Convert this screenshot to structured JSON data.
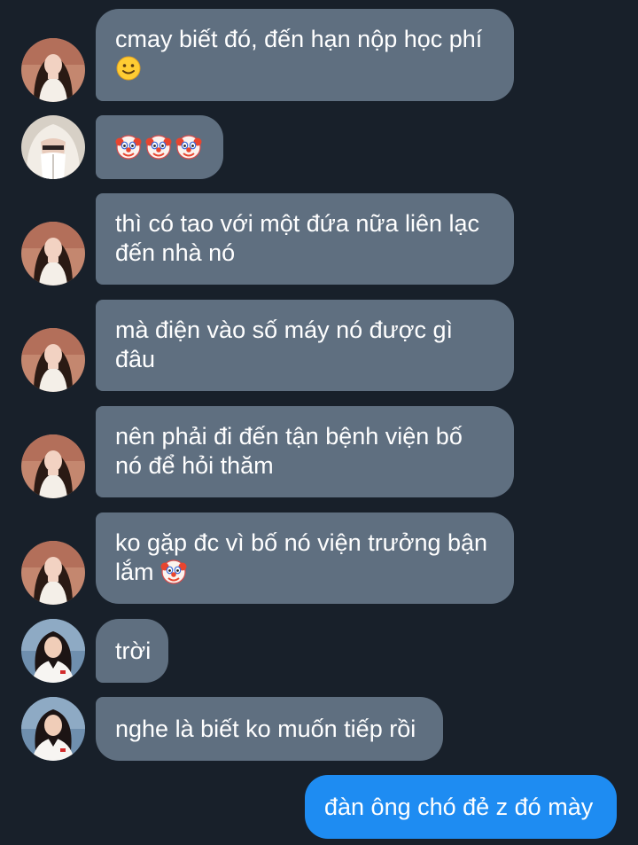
{
  "messages": [
    {
      "sender": "friend_a",
      "line1": "cmay biết đó, đến hạn nộp học phí",
      "emoji": "slightly-smiling-face"
    },
    {
      "sender": "friend_b",
      "emoji": "clown-face",
      "emoji_count": 3
    },
    {
      "sender": "friend_a",
      "line1": "thì có tao với một đứa nữa liên lạc",
      "line2": "đến nhà nó"
    },
    {
      "sender": "friend_a",
      "line1": "mà điện vào số máy nó được gì",
      "line2": "đâu"
    },
    {
      "sender": "friend_a",
      "line1": "nên phải đi đến tận bệnh viện bố",
      "line2": "nó để hỏi thăm"
    },
    {
      "sender": "friend_a",
      "line1": "ko gặp đc vì bố nó viện trưởng bận",
      "line2": "lắm",
      "emoji": "clown-face"
    },
    {
      "sender": "friend_c",
      "text": "trời"
    },
    {
      "sender": "friend_c",
      "text": "nghe là biết ko muốn tiếp rồi"
    },
    {
      "sender": "me",
      "text": "đàn ông chó đẻ z đó mày"
    }
  ],
  "colors": {
    "background": "#18202a",
    "incoming_bubble": "#5f6f80",
    "outgoing_bubble": "#1e8cf2",
    "text": "#ffffff"
  },
  "avatars": {
    "friend_a": "avatar-photo-woman-long-hair",
    "friend_b": "avatar-photo-person-white-hood",
    "friend_c": "avatar-photo-woman-black-hair"
  }
}
